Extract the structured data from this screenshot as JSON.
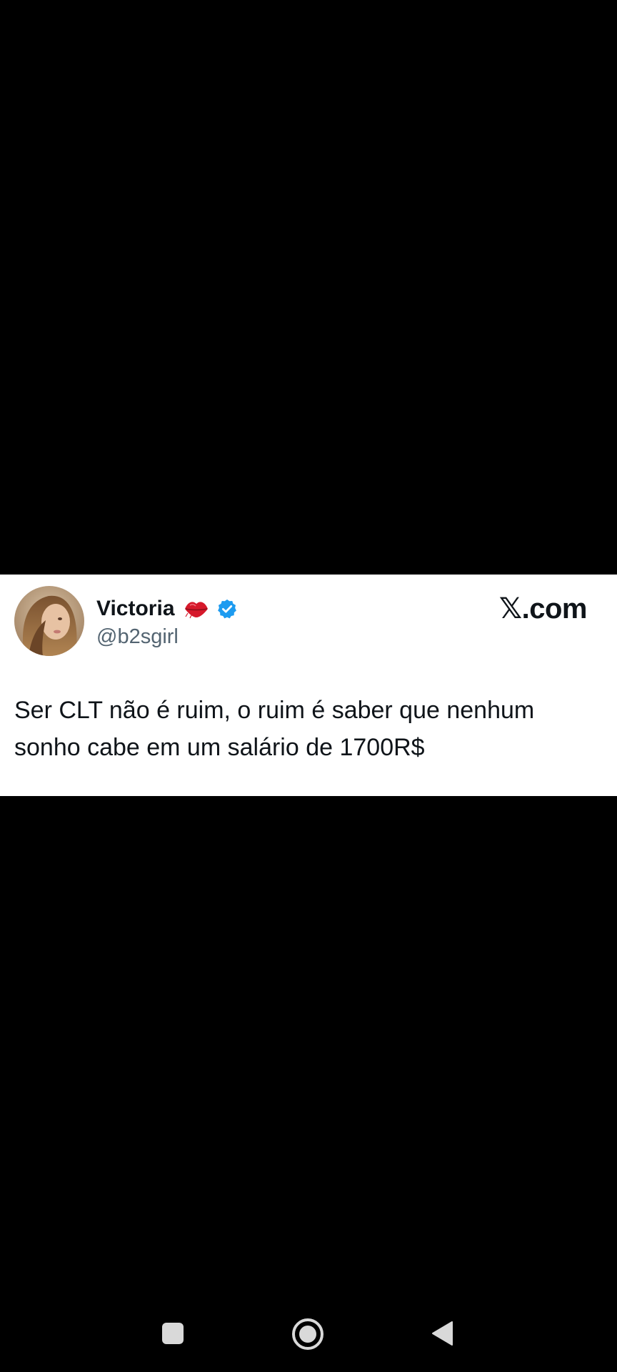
{
  "tweet": {
    "display_name": "Victoria",
    "handle": "@b2sgirl",
    "site_x": "𝕏",
    "site_domain": ".com",
    "text": "Ser CLT não é ruim, o ruim é saber que nenhum sonho cabe em um salário de 1700R$",
    "icons": {
      "name_emoji": "lips-kiss-icon",
      "verified": "verified-badge-icon",
      "avatar": "profile-photo"
    },
    "colors": {
      "verified": "#1d9bf0",
      "handle": "#536471",
      "text": "#0f1419",
      "lips": "#d6192b"
    }
  },
  "navbar": {
    "buttons": [
      "recents-icon",
      "home-icon",
      "back-icon"
    ],
    "color": "#d9d9d9"
  }
}
